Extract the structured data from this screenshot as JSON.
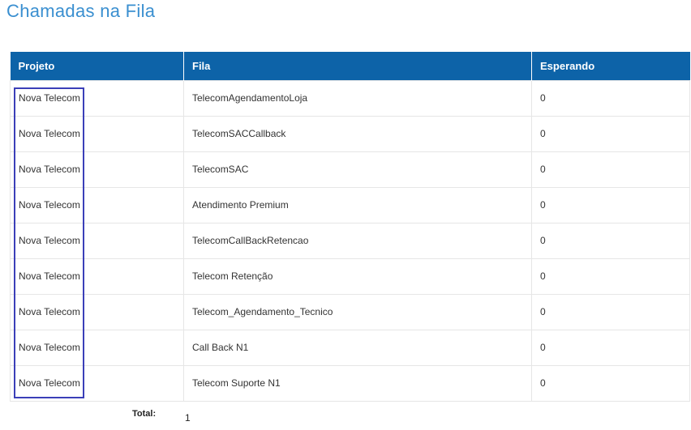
{
  "page": {
    "title": "Chamadas na Fila"
  },
  "table": {
    "headers": {
      "projeto": "Projeto",
      "fila": "Fila",
      "esperando": "Esperando"
    },
    "rows": [
      {
        "projeto": "Nova Telecom",
        "fila": "TelecomAgendamentoLoja",
        "esperando": "0"
      },
      {
        "projeto": "Nova Telecom",
        "fila": "TelecomSACCallback",
        "esperando": "0"
      },
      {
        "projeto": "Nova Telecom",
        "fila": "TelecomSAC",
        "esperando": "0"
      },
      {
        "projeto": "Nova Telecom",
        "fila": "Atendimento Premium",
        "esperando": "0"
      },
      {
        "projeto": "Nova Telecom",
        "fila": "TelecomCallBackRetencao",
        "esperando": "0"
      },
      {
        "projeto": "Nova Telecom",
        "fila": "Telecom Retenção",
        "esperando": "0"
      },
      {
        "projeto": "Nova Telecom",
        "fila": "Telecom_Agendamento_Tecnico",
        "esperando": "0"
      },
      {
        "projeto": "Nova Telecom",
        "fila": "Call Back N1",
        "esperando": "0"
      },
      {
        "projeto": "Nova Telecom",
        "fila": "Telecom Suporte N1",
        "esperando": "0"
      }
    ]
  },
  "footer": {
    "total_label": "Total:",
    "total_value": "1"
  },
  "colors": {
    "title": "#3a8fd0",
    "header_bg": "#0d63a8",
    "highlight_border": "#3b3fb8"
  }
}
